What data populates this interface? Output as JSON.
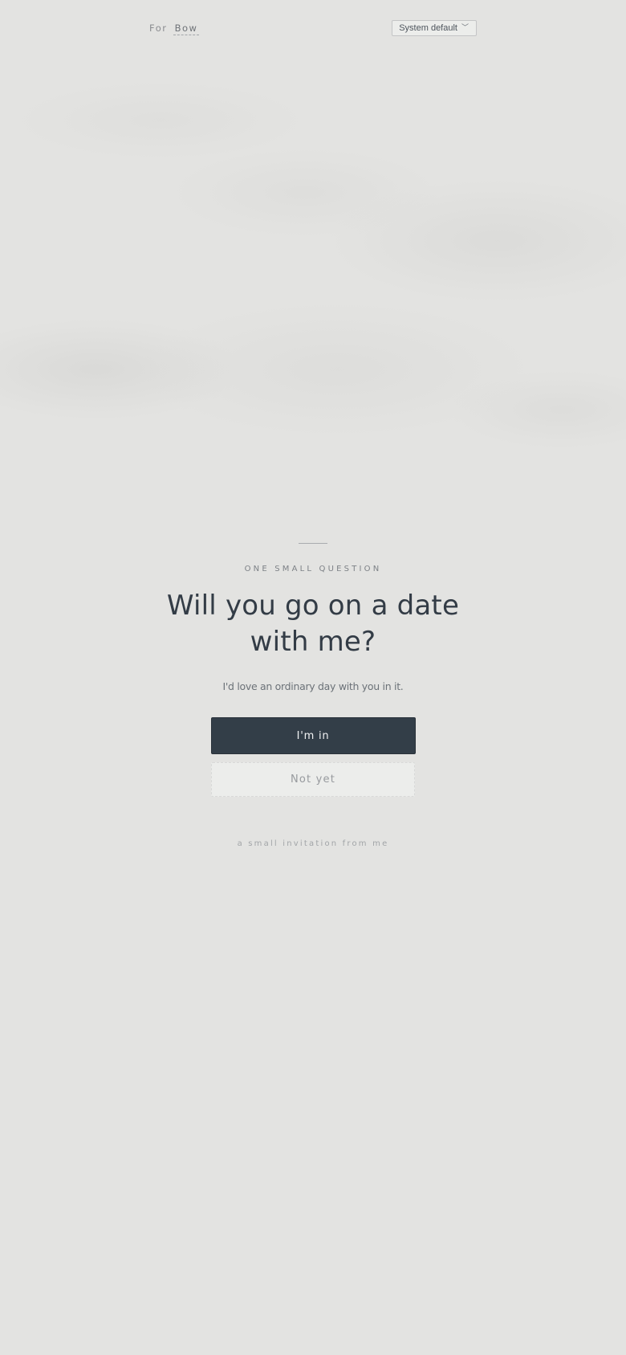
{
  "header": {
    "for_prefix": "For",
    "recipient_name": "Bow",
    "language_select": {
      "selected": "System default",
      "icon": "chevron-down-icon"
    }
  },
  "card": {
    "eyebrow": "ONE SMALL QUESTION",
    "question": "Will you go on a date with me?",
    "subline": "I'd love an ordinary day with you in it.",
    "primary_button": "I'm in",
    "secondary_button": "Not yet",
    "footer_note": "a small invitation from me"
  },
  "colors": {
    "background": "#e3e3e1",
    "primary_button": "#333e48",
    "headline_text": "#333c46"
  }
}
